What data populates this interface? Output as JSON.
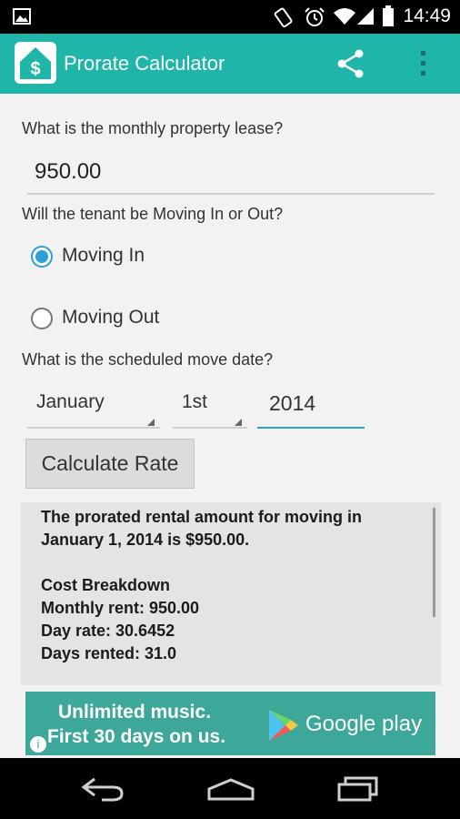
{
  "status_bar": {
    "time": "14:49",
    "icons": [
      "image-icon",
      "rotate-icon",
      "alarm-icon",
      "wifi-icon",
      "signal-icon",
      "battery-icon"
    ]
  },
  "app_bar": {
    "title": "Prorate Calculator",
    "icon_symbol": "$",
    "accent_color": "#1fb5a8"
  },
  "form": {
    "lease_question": "What is the monthly property lease?",
    "lease_value": "950.00",
    "tenant_question": "Will the tenant be Moving In or Out?",
    "options": [
      {
        "label": "Moving In",
        "checked": true
      },
      {
        "label": "Moving Out",
        "checked": false
      }
    ],
    "date_question": "What is the scheduled move date?",
    "month": "January",
    "day": "1st",
    "year": "2014",
    "calculate_label": "Calculate Rate"
  },
  "result": {
    "lines": [
      "The prorated rental amount for moving in",
      "January 1, 2014 is $950.00.",
      "",
      "Cost Breakdown",
      "Monthly rent: 950.00",
      "Day rate: 30.6452",
      "Days rented: 31.0"
    ]
  },
  "ad": {
    "line1": "Unlimited music.",
    "line2": "First 30 days on us.",
    "brand": "Google play",
    "info": "i",
    "bg_color": "#3da79a"
  },
  "nav_bar": {
    "icons": [
      "back-icon",
      "home-icon",
      "recents-icon"
    ]
  }
}
